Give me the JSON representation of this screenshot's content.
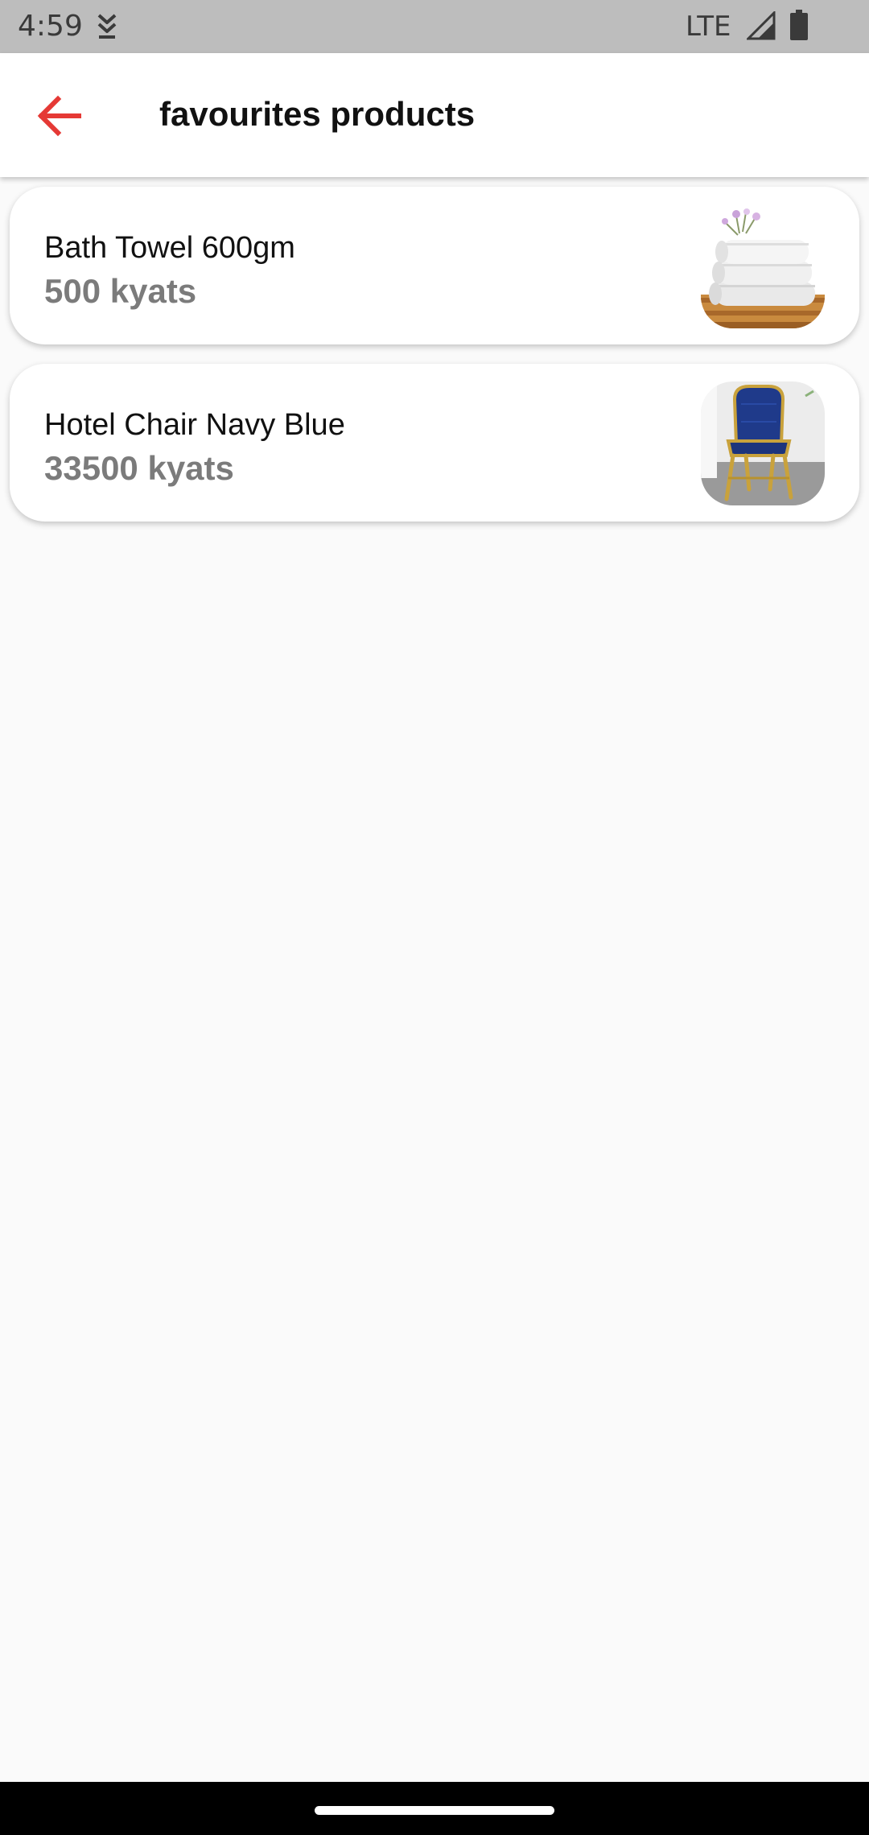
{
  "status_bar": {
    "time": "4:59",
    "network": "LTE",
    "icons": [
      "download-icon",
      "signal-icon",
      "battery-icon"
    ]
  },
  "app_bar": {
    "back_icon": "arrow-back-icon",
    "title": "favourites products",
    "accent_color": "#e53935"
  },
  "products": [
    {
      "name": "Bath Towel 600gm",
      "price": "500 kyats",
      "image": "towel-stack-image"
    },
    {
      "name": "Hotel Chair Navy Blue",
      "price": "33500 kyats",
      "image": "navy-chair-image"
    }
  ],
  "colors": {
    "background": "#fafafa",
    "card": "#ffffff",
    "price_text": "#7b7b7b",
    "status_bar": "#bdbdbd"
  }
}
